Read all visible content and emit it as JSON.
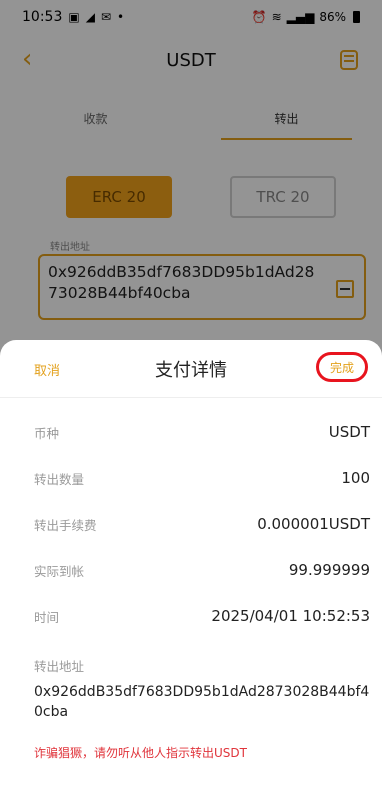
{
  "status_bar": {
    "time": "10:53",
    "left_icons": [
      "gallery-icon",
      "send-icon",
      "mail-icon"
    ],
    "battery": "86%"
  },
  "nav": {
    "title": "USDT"
  },
  "tabs": [
    {
      "label": "收款",
      "active": false
    },
    {
      "label": "转出",
      "active": true
    }
  ],
  "chains": {
    "erc": "ERC 20",
    "trc": "TRC 20"
  },
  "address_form": {
    "label": "转出地址",
    "value": "0x926ddB35df7683DD95b1dAd2873028B44bf40cba"
  },
  "sheet": {
    "cancel": "取消",
    "title": "支付详情",
    "done": "完成",
    "rows": [
      {
        "label": "币种",
        "value": "USDT"
      },
      {
        "label": "转出数量",
        "value": "100"
      },
      {
        "label": "转出手续费",
        "value": "0.000001USDT"
      },
      {
        "label": "实际到帐",
        "value": "99.999999"
      },
      {
        "label": "时间",
        "value": "2025/04/01 10:52:53"
      }
    ],
    "address_label": "转出地址",
    "address_value": "0x926ddB35df7683DD95b1dAd2873028B44bf40cba",
    "warning": "诈骗猖獗，请勿听从他人指示转出USDT"
  },
  "colors": {
    "accent": "#e3a11d",
    "highlight_ring": "#e8141e",
    "warning": "#e0343b"
  }
}
